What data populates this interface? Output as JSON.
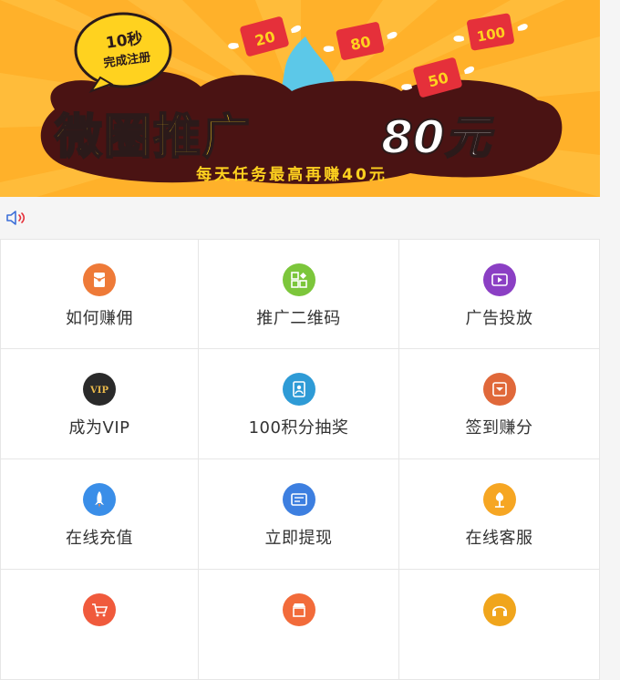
{
  "banner": {
    "badge_line1": "10秒",
    "badge_line2": "完成注册",
    "title_main": "微圈推广",
    "title_amount": "80元",
    "subtitle": "每天任务最高再赚40元",
    "envelope_values": [
      "20",
      "80",
      "100",
      "50"
    ],
    "colors": {
      "background": "#ffb12a",
      "title": "#ffd21f",
      "cloud": "#4a1313"
    }
  },
  "notice": {
    "icon": "speaker-icon"
  },
  "menu": [
    {
      "label": "如何赚佣",
      "icon": "red-envelope-icon",
      "color": "#ee7a38"
    },
    {
      "label": "推广二维码",
      "icon": "qrcode-icon",
      "color": "#7cc63b"
    },
    {
      "label": "广告投放",
      "icon": "video-icon",
      "color": "#8b3fc4"
    },
    {
      "label": "成为VIP",
      "icon": "vip-icon",
      "color": "#2a2a2a"
    },
    {
      "label": "100积分抽奖",
      "icon": "lottery-icon",
      "color": "#2e9bd6"
    },
    {
      "label": "签到赚分",
      "icon": "checkin-icon",
      "color": "#e0683a"
    },
    {
      "label": "在线充值",
      "icon": "rocket-icon",
      "color": "#3a8ee8"
    },
    {
      "label": "立即提现",
      "icon": "withdraw-icon",
      "color": "#3d7fe0"
    },
    {
      "label": "在线客服",
      "icon": "tree-icon",
      "color": "#f6a623"
    },
    {
      "label": "",
      "icon": "cart-icon",
      "color": "#f05a3c"
    },
    {
      "label": "",
      "icon": "shop-icon",
      "color": "#f26b3a"
    },
    {
      "label": "",
      "icon": "headset-icon",
      "color": "#f0a51c"
    }
  ]
}
